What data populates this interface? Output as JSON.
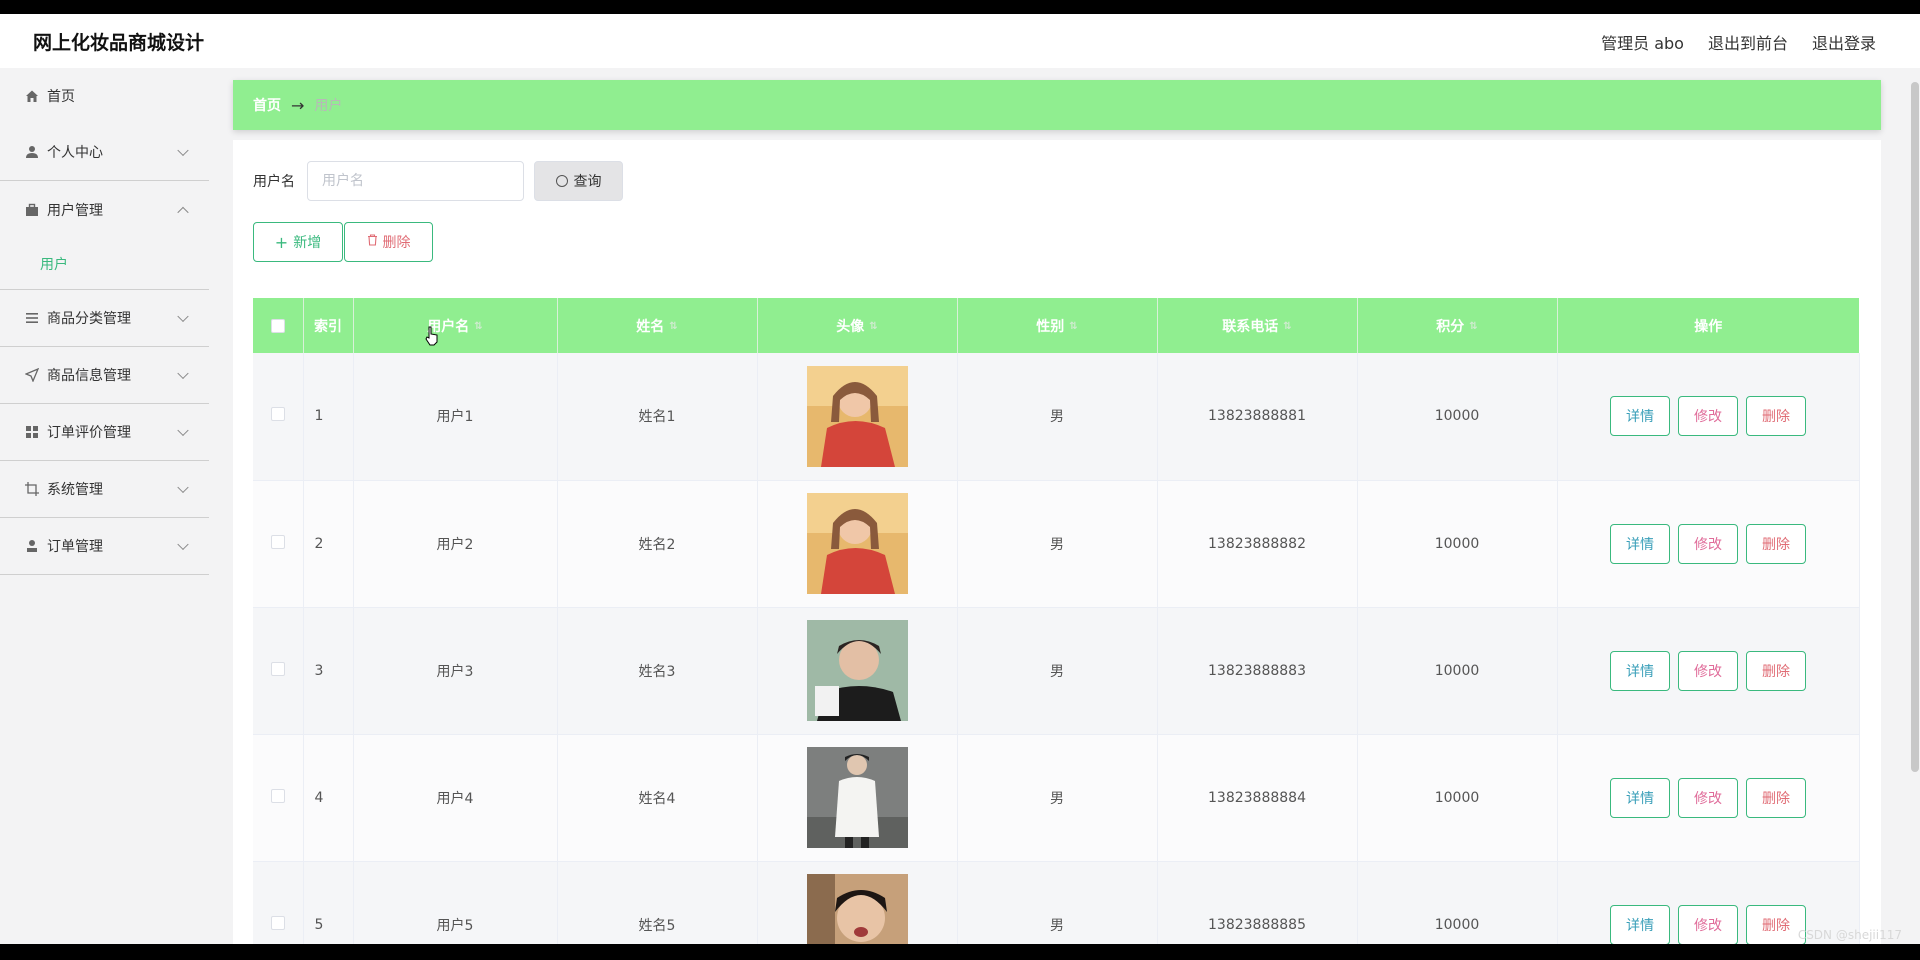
{
  "app": {
    "title": "网上化妆品商城设计"
  },
  "topbar": {
    "admin": "管理员 abo",
    "to_front": "退出到前台",
    "logout": "退出登录"
  },
  "sidebar": {
    "items": [
      {
        "label": "首页",
        "icon": "home-icon"
      },
      {
        "label": "个人中心",
        "icon": "person-icon"
      },
      {
        "label": "用户管理",
        "icon": "briefcase-icon"
      },
      {
        "label": "商品分类管理",
        "icon": "list-icon"
      },
      {
        "label": "商品信息管理",
        "icon": "send-icon"
      },
      {
        "label": "订单评价管理",
        "icon": "grid-icon"
      },
      {
        "label": "系统管理",
        "icon": "crop-icon"
      },
      {
        "label": "订单管理",
        "icon": "user-stamp-icon"
      }
    ],
    "submenu_user": "用户"
  },
  "breadcrumb": {
    "home": "首页",
    "sep": "→",
    "current": "用户"
  },
  "search": {
    "label": "用户名",
    "placeholder": "用户名",
    "button": "查询"
  },
  "actions": {
    "add": "新增",
    "delete": "删除"
  },
  "table": {
    "headers": [
      "索引",
      "用户名",
      "姓名",
      "头像",
      "性别",
      "联系电话",
      "积分",
      "操作"
    ],
    "rows": [
      {
        "index": "1",
        "username": "用户1",
        "name": "姓名1",
        "gender": "男",
        "phone": "13823888881",
        "points": "10000"
      },
      {
        "index": "2",
        "username": "用户2",
        "name": "姓名2",
        "gender": "男",
        "phone": "13823888882",
        "points": "10000"
      },
      {
        "index": "3",
        "username": "用户3",
        "name": "姓名3",
        "gender": "男",
        "phone": "13823888883",
        "points": "10000"
      },
      {
        "index": "4",
        "username": "用户4",
        "name": "姓名4",
        "gender": "男",
        "phone": "13823888884",
        "points": "10000"
      },
      {
        "index": "5",
        "username": "用户5",
        "name": "姓名5",
        "gender": "男",
        "phone": "13823888885",
        "points": "10000"
      }
    ],
    "row_actions": {
      "detail": "详情",
      "edit": "修改",
      "delete": "删除"
    }
  },
  "watermark": "CSDN @shejii117",
  "colors": {
    "accent_green": "#90ee90",
    "button_green": "#3ab97e",
    "danger": "#e06c75"
  }
}
